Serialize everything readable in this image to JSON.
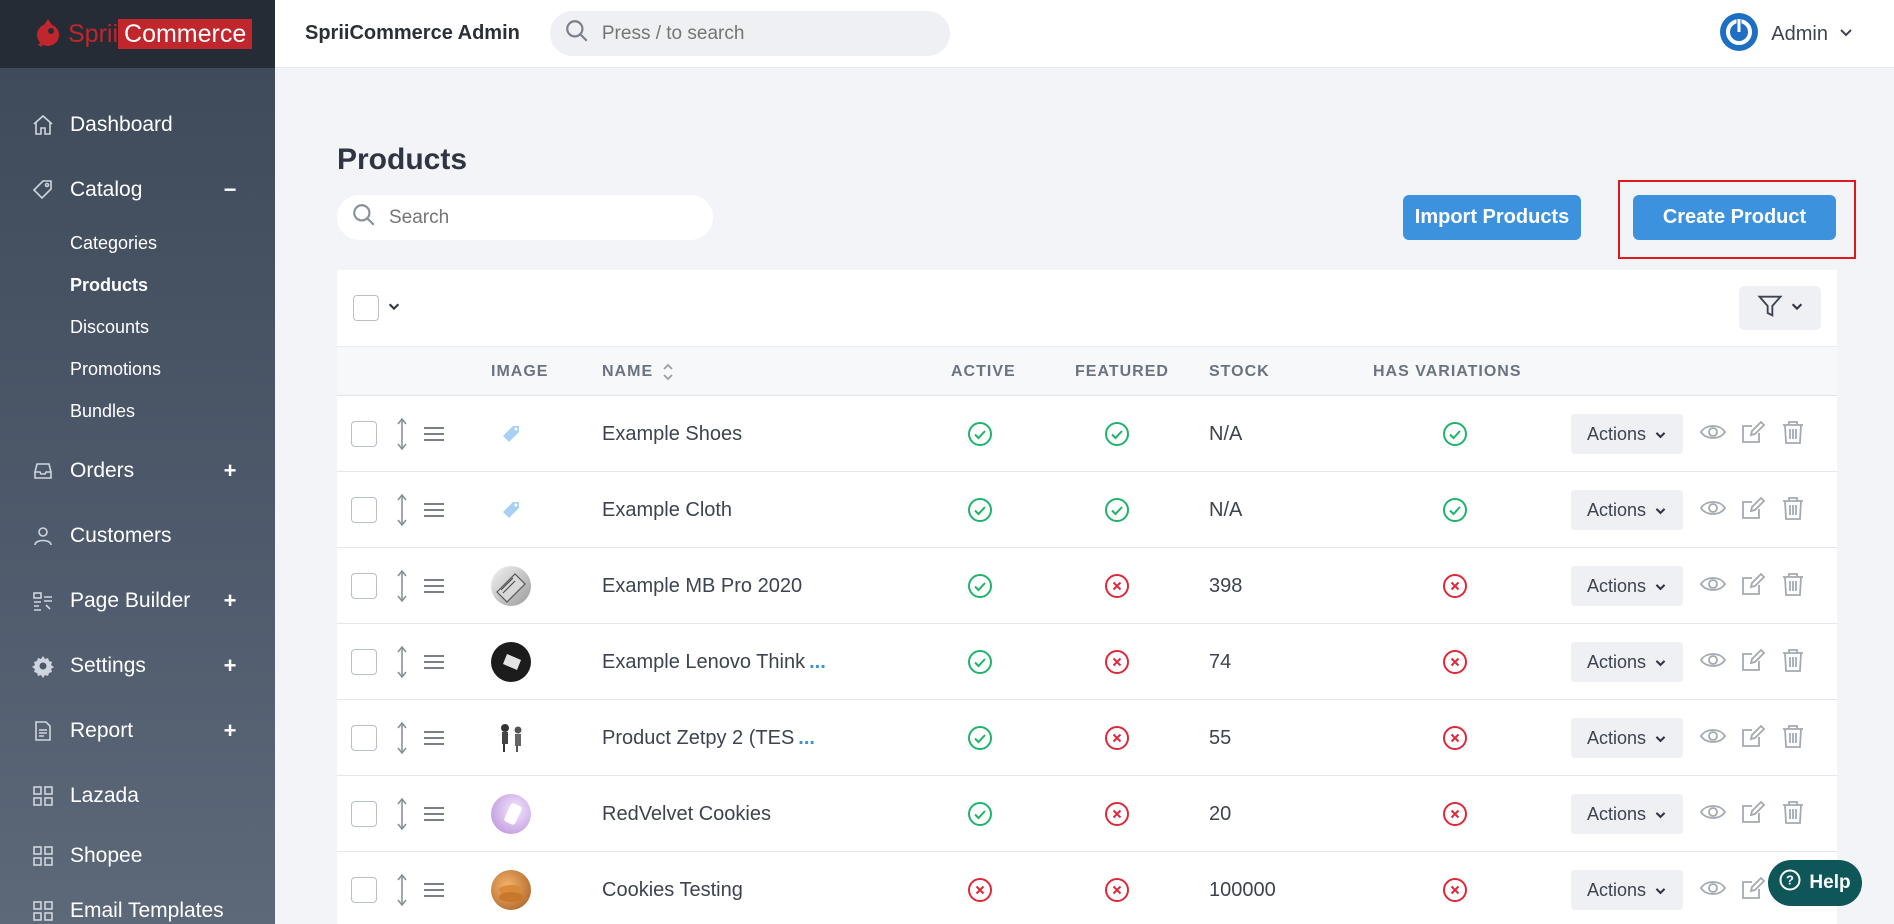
{
  "logo": {
    "part1": "Sprii",
    "part2": "Commerce"
  },
  "topbar": {
    "brand": "SpriiCommerce Admin",
    "search_placeholder": "Press / to search",
    "user_name": "Admin"
  },
  "sidebar": {
    "items": [
      {
        "label": "Dashboard",
        "icon": "home-icon",
        "sign": ""
      },
      {
        "label": "Catalog",
        "icon": "tag-icon",
        "sign": "−"
      },
      {
        "label": "Orders",
        "icon": "inbox-icon",
        "sign": "+"
      },
      {
        "label": "Customers",
        "icon": "user-icon",
        "sign": ""
      },
      {
        "label": "Page Builder",
        "icon": "page-builder-icon",
        "sign": "+"
      },
      {
        "label": "Settings",
        "icon": "gear-icon",
        "sign": "+"
      },
      {
        "label": "Report",
        "icon": "report-icon",
        "sign": "+"
      },
      {
        "label": "Lazada",
        "icon": "grid-icon",
        "sign": ""
      },
      {
        "label": "Shopee",
        "icon": "grid-icon",
        "sign": ""
      },
      {
        "label": "Email Templates",
        "icon": "grid-icon",
        "sign": ""
      }
    ],
    "catalog_sub": [
      "Categories",
      "Products",
      "Discounts",
      "Promotions",
      "Bundles"
    ],
    "active_sub": "Products"
  },
  "page": {
    "title": "Products",
    "search_placeholder": "Search",
    "import_label": "Import Products",
    "create_label": "Create Product"
  },
  "table": {
    "headers": {
      "image": "IMAGE",
      "name": "NAME",
      "active": "ACTIVE",
      "featured": "FEATURED",
      "stock": "STOCK",
      "variations": "HAS VARIATIONS"
    },
    "actions_label": "Actions",
    "more_label": "...",
    "rows": [
      {
        "name": "Example Shoes",
        "truncated": false,
        "active": true,
        "featured": true,
        "stock": "N/A",
        "variations": true,
        "image": "tag-placeholder"
      },
      {
        "name": "Example Cloth",
        "truncated": false,
        "active": true,
        "featured": true,
        "stock": "N/A",
        "variations": true,
        "image": "tag-placeholder"
      },
      {
        "name": "Example MB Pro 2020",
        "truncated": false,
        "active": true,
        "featured": false,
        "stock": "398",
        "variations": false,
        "image": "laptop-photo"
      },
      {
        "name": "Example Lenovo Think",
        "truncated": true,
        "active": true,
        "featured": false,
        "stock": "74",
        "variations": false,
        "image": "dark-laptop-photo"
      },
      {
        "name": "Product Zetpy 2 (TES",
        "truncated": true,
        "active": true,
        "featured": false,
        "stock": "55",
        "variations": false,
        "image": "figures-photo"
      },
      {
        "name": "RedVelvet Cookies",
        "truncated": false,
        "active": true,
        "featured": false,
        "stock": "20",
        "variations": false,
        "image": "purple-photo"
      },
      {
        "name": "Cookies Testing",
        "truncated": false,
        "active": false,
        "featured": false,
        "stock": "100000",
        "variations": false,
        "image": "cookies-photo"
      }
    ]
  },
  "help": {
    "label": "Help"
  },
  "colors": {
    "primary": "#3d92dd",
    "success": "#1fb36b",
    "danger": "#e0283a",
    "brand_red": "#c0262b",
    "help_bg": "#0f5659"
  }
}
